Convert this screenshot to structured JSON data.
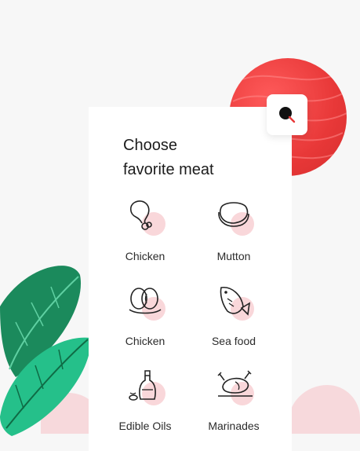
{
  "title": {
    "line1": "Choose",
    "line2": "favorite meat"
  },
  "search": {
    "icon": "search-icon"
  },
  "categories": [
    {
      "label": "Chicken",
      "icon": "chicken-leg-icon"
    },
    {
      "label": "Mutton",
      "icon": "steak-icon"
    },
    {
      "label": "Chicken",
      "icon": "eggs-icon"
    },
    {
      "label": "Sea food",
      "icon": "fish-icon"
    },
    {
      "label": "Edible Oils",
      "icon": "oil-bottle-icon"
    },
    {
      "label": "Marinades",
      "icon": "roast-chicken-icon"
    }
  ],
  "colors": {
    "accent": "#e83838",
    "icon_blob": "#f9d7da",
    "leaf_dark": "#1f8a5f",
    "leaf_light": "#23bf86"
  }
}
